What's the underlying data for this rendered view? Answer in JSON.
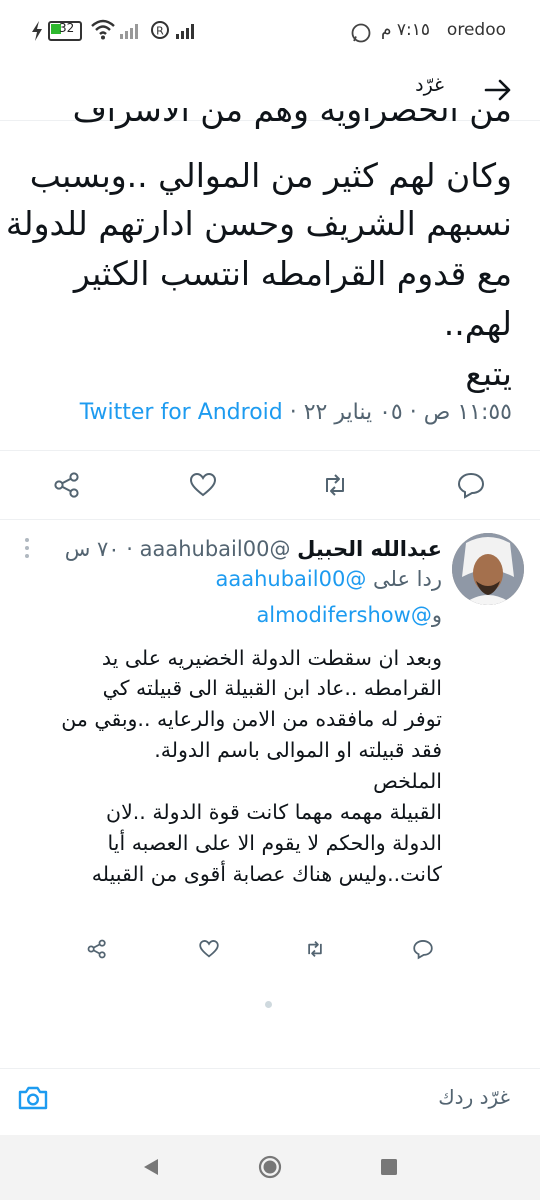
{
  "status_bar": {
    "carrier": "oredoo",
    "time": "٧:١٥ م",
    "battery": "32"
  },
  "header": {
    "title": "غرّد"
  },
  "tweet": {
    "lines": [
      "من الخضراوية وهم من الأشراف",
      "وكان لهم كثير من الموالي ..وبسبب",
      "نسبهم الشريف وحسن ادارتهم للدولة",
      "مع قدوم القرامطه انتسب الكثير",
      "لهم..",
      "يتبع"
    ],
    "date": "١١:٥٥ ص · ٠٥ يناير ٢٢ · ",
    "source": "Twitter for Android"
  },
  "reply": {
    "name": "عبدالله الحبيل",
    "handle": "@aaahubail00",
    "time": "٧٠ س",
    "replying_prefix": "ردا على",
    "replying_handle_1": "@aaahubail00",
    "replying_and": "و",
    "replying_handle_2": "@almodifershow",
    "lines": [
      "وبعد ان سقطت الدولة الخضيريه على يد",
      "القرامطه ..عاد ابن القبيلة الى قبيلته كي",
      "توفر له مافقده من الامن والرعايه ..وبقي من",
      "فقد قبيلته او الموالى باسم الدولة.",
      "الملخص",
      "القبيلة مهمه مهما كانت قوة الدولة ..لان",
      "الدولة والحكم لا يقوم الا على العصبه أيا",
      "كانت..وليس هناك عصابة أقوى من القبيله"
    ]
  },
  "compose": {
    "placeholder": "غرّد ردك"
  },
  "colors": {
    "accent": "#1d9bf0",
    "muted": "#536471",
    "text": "#0f1419",
    "icon": "#536471"
  },
  "icons": {
    "back": "arrow-right-icon",
    "share": "share-icon",
    "like": "heart-icon",
    "retweet": "retweet-icon",
    "reply": "reply-icon",
    "camera": "camera-icon",
    "more": "more-vertical-icon"
  }
}
